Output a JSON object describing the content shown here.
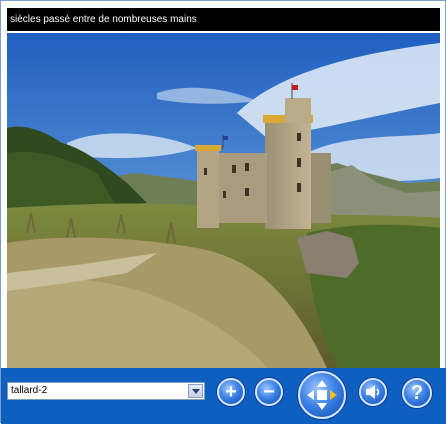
{
  "caption": {
    "text": "siècles passé entre de nombreuses mains"
  },
  "scene_selector": {
    "selected": "tallard-2",
    "arrow_icon": "chevron-down-icon"
  },
  "controls": {
    "zoom_in_label": "+",
    "zoom_out_label": "−",
    "navigation_icon": "directional-pad-icon",
    "sound_icon": "speaker-icon",
    "help_label": "?"
  },
  "colors": {
    "control_bar": "#0f5fc0",
    "button_blue": "#3e83e6",
    "caption_bg": "#000000",
    "accent_yellow": "#f0c020"
  }
}
